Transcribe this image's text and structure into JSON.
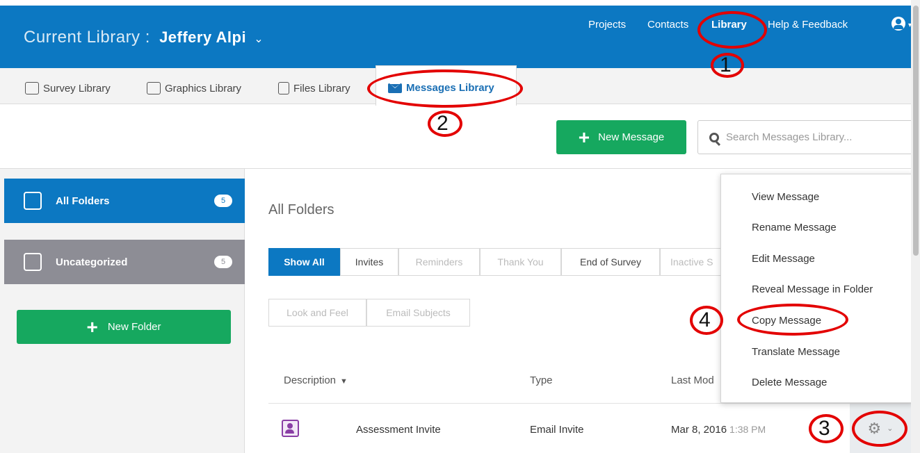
{
  "header": {
    "title_prefix": "Current Library :",
    "library_name": "Jeffery Alpi",
    "chevron": "⌄",
    "nav": [
      "Projects",
      "Contacts",
      "Library",
      "Help & Feedback"
    ],
    "user_caret": "▾"
  },
  "library_tabs": [
    "Survey Library",
    "Graphics Library",
    "Files Library",
    "Messages Library"
  ],
  "toolbar": {
    "new_message_label": "New Message",
    "search_placeholder": "Search Messages Library..."
  },
  "sidebar": {
    "folders": [
      {
        "label": "All Folders",
        "count": "5"
      },
      {
        "label": "Uncategorized",
        "count": "5"
      }
    ],
    "new_folder_label": "New Folder"
  },
  "main": {
    "title": "All Folders",
    "filters": [
      "Show All",
      "Invites",
      "Reminders",
      "Thank You",
      "End of Survey",
      "Inactive S",
      "Look and Feel",
      "Email Subjects"
    ],
    "columns": [
      "Description",
      "Type",
      "Last Mod"
    ],
    "sort_arrow": "▼",
    "row": {
      "description": "Assessment Invite",
      "type": "Email Invite",
      "date": "Mar 8, 2016",
      "time": "1:38 PM"
    }
  },
  "context_menu": [
    "View Message",
    "Rename Message",
    "Edit Message",
    "Reveal Message in Folder",
    "Copy Message",
    "Translate Message",
    "Delete Message"
  ],
  "annotations": [
    "1",
    "2",
    "3",
    "4"
  ],
  "colors": {
    "brand_blue": "#0c78c2",
    "action_green": "#16a85f",
    "annotation_red": "#e30000",
    "uncategorized_gray": "#8d8d95"
  },
  "icons": [
    "user-icon",
    "survey-library-icon",
    "graphics-library-icon",
    "files-library-icon",
    "envelope-icon",
    "plus-icon",
    "search-icon",
    "folder-list-icon",
    "folder-tray-icon",
    "contact-message-icon",
    "gear-icon",
    "chevron-down-icon"
  ]
}
